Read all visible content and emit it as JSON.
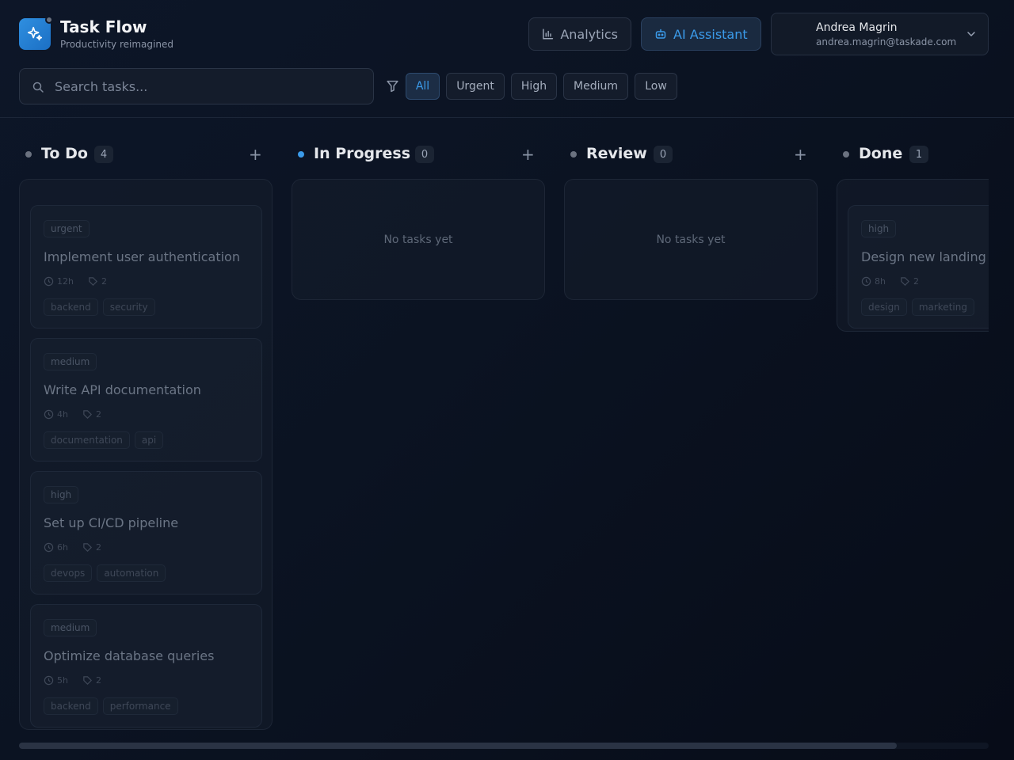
{
  "app": {
    "title": "Task Flow",
    "subtitle": "Productivity reimagined"
  },
  "header": {
    "analytics_label": "Analytics",
    "ai_label": "AI Assistant",
    "user": {
      "name": "Andrea Magrin",
      "email": "andrea.magrin@taskade.com"
    }
  },
  "search": {
    "placeholder": "Search tasks...",
    "value": ""
  },
  "filters": [
    "All",
    "Urgent",
    "High",
    "Medium",
    "Low"
  ],
  "active_filter": "All",
  "columns": [
    {
      "title": "To Do",
      "count": "4",
      "dot": "gray",
      "tasks": [
        {
          "priority": "urgent",
          "title": "Implement user authentication",
          "hours": "12h",
          "tag_count": "2",
          "tags": [
            "backend",
            "security"
          ]
        },
        {
          "priority": "medium",
          "title": "Write API documentation",
          "hours": "4h",
          "tag_count": "2",
          "tags": [
            "documentation",
            "api"
          ]
        },
        {
          "priority": "high",
          "title": "Set up CI/CD pipeline",
          "hours": "6h",
          "tag_count": "2",
          "tags": [
            "devops",
            "automation"
          ]
        },
        {
          "priority": "medium",
          "title": "Optimize database queries",
          "hours": "5h",
          "tag_count": "2",
          "tags": [
            "backend",
            "performance"
          ]
        }
      ]
    },
    {
      "title": "In Progress",
      "count": "0",
      "dot": "blue",
      "empty_text": "No tasks yet",
      "tasks": []
    },
    {
      "title": "Review",
      "count": "0",
      "dot": "gray",
      "empty_text": "No tasks yet",
      "tasks": []
    },
    {
      "title": "Done",
      "count": "1",
      "dot": "gray",
      "tasks": [
        {
          "priority": "high",
          "title": "Design new landing",
          "hours": "8h",
          "tag_count": "2",
          "tags": [
            "design",
            "marketing"
          ]
        }
      ]
    }
  ],
  "colors": {
    "accent": "#3b9bea",
    "background": "#0b1322"
  }
}
